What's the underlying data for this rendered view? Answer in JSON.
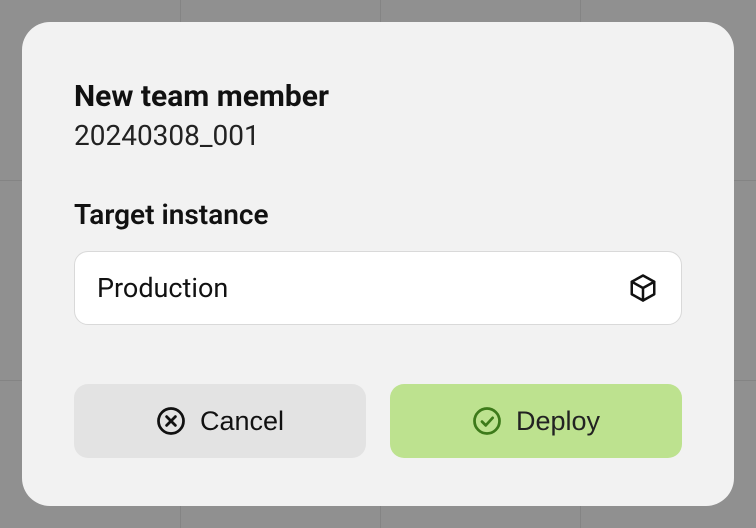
{
  "modal": {
    "title": "New team member",
    "subtitle": "20240308_001",
    "target_label": "Target instance",
    "target_value": "Production",
    "cancel_label": "Cancel",
    "deploy_label": "Deploy"
  }
}
